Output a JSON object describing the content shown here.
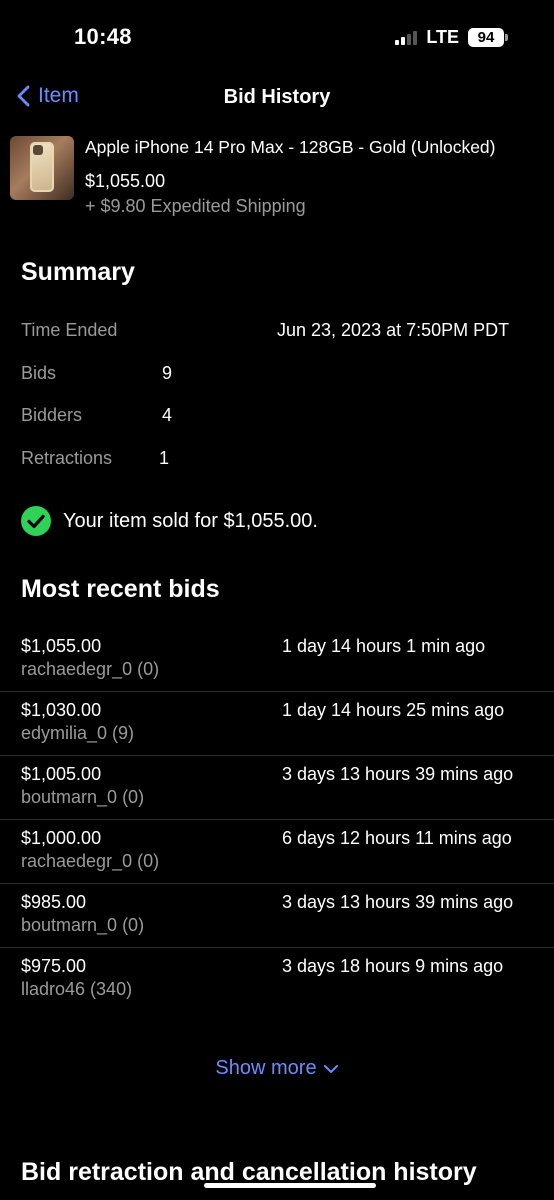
{
  "status_bar": {
    "time": "10:48",
    "network": "LTE",
    "battery": "94"
  },
  "nav": {
    "back_label": "Item",
    "title": "Bid History"
  },
  "item": {
    "title": "Apple iPhone 14 Pro Max - 128GB - Gold (Unlocked)",
    "price": "$1,055.00",
    "shipping": "+ $9.80 Expedited Shipping"
  },
  "summary": {
    "heading": "Summary",
    "time_ended_label": "Time Ended",
    "time_ended_value": "Jun 23, 2023 at 7:50PM PDT",
    "bids_label": "Bids",
    "bids_value": "9",
    "bidders_label": "Bidders",
    "bidders_value": "4",
    "retractions_label": "Retractions",
    "retractions_value": "1",
    "sold_message": "Your item sold for $1,055.00."
  },
  "recent_bids": {
    "heading": "Most recent bids",
    "rows": [
      {
        "amount": "$1,055.00",
        "bidder": "rachaedegr_0 (0)",
        "time": "1 day 14 hours 1 min ago"
      },
      {
        "amount": "$1,030.00",
        "bidder": "edymilia_0 (9)",
        "time": "1 day 14 hours 25 mins ago"
      },
      {
        "amount": "$1,005.00",
        "bidder": "boutmarn_0 (0)",
        "time": "3 days 13 hours 39 mins ago"
      },
      {
        "amount": "$1,000.00",
        "bidder": "rachaedegr_0 (0)",
        "time": "6 days 12 hours 11 mins ago"
      },
      {
        "amount": "$985.00",
        "bidder": "boutmarn_0 (0)",
        "time": "3 days 13 hours 39 mins ago"
      },
      {
        "amount": "$975.00",
        "bidder": "lladro46 (340)",
        "time": "3 days 18 hours 9 mins ago"
      }
    ],
    "show_more": "Show more"
  },
  "retraction": {
    "heading": "Bid retraction and cancellation history"
  },
  "colors": {
    "accent": "#6b8cff",
    "success": "#2fd158",
    "muted": "#9a9a9a"
  }
}
